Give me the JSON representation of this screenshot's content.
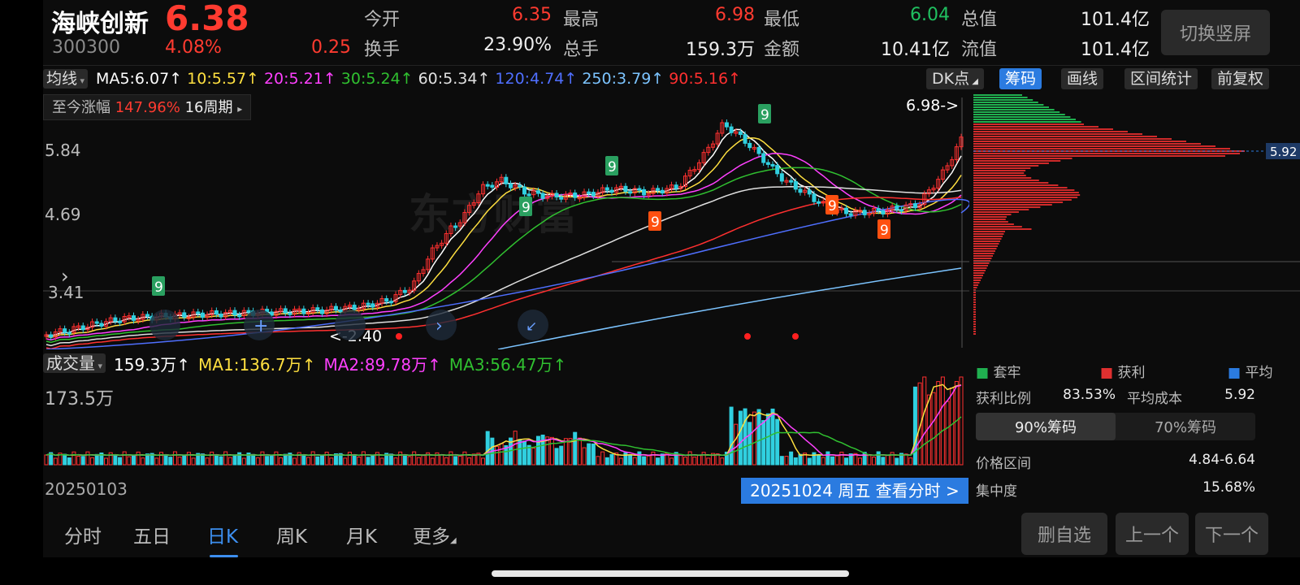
{
  "header": {
    "name": "海峡创新",
    "price": "6.38",
    "code": "300300",
    "pct": "4.08%",
    "chg": "0.25",
    "quotes": [
      {
        "label": "今开",
        "value": "6.35",
        "color": "red"
      },
      {
        "label": "最高",
        "value": "6.98",
        "color": "red"
      },
      {
        "label": "最低",
        "value": "6.04",
        "color": "green"
      },
      {
        "label": "总值",
        "value": "101.4亿",
        "color": "white"
      },
      {
        "label": "换手",
        "value": "23.90%",
        "color": "white"
      },
      {
        "label": "总手",
        "value": "159.3万",
        "color": "white"
      },
      {
        "label": "金额",
        "value": "10.41亿",
        "color": "white"
      },
      {
        "label": "流值",
        "value": "101.4亿",
        "color": "white"
      }
    ],
    "switch_label": "切换竖屏"
  },
  "ma_bar": {
    "selector": "均线",
    "items": [
      {
        "text": "MA5:6.07↑",
        "color": "#ffffff"
      },
      {
        "text": "10:5.57↑",
        "color": "#ffe040"
      },
      {
        "text": "20:5.21↑",
        "color": "#ff40ff"
      },
      {
        "text": "30:5.24↑",
        "color": "#30c030"
      },
      {
        "text": "60:5.34↑",
        "color": "#e0e0e0"
      },
      {
        "text": "120:4.74↑",
        "color": "#4f6fff"
      },
      {
        "text": "250:3.79↑",
        "color": "#7cc4ff"
      },
      {
        "text": "90:5.16↑",
        "color": "#ff3030"
      }
    ]
  },
  "tools": {
    "dk": "DK点",
    "chips": "筹码",
    "draw": "画线",
    "range": "区间统计",
    "fq": "前复权"
  },
  "since": {
    "label": "至今涨幅",
    "value": "147.96%",
    "period": "16周期"
  },
  "price_chart": {
    "y_labels": [
      "5.84",
      "4.69",
      "3.41"
    ],
    "high_label": "6.98->",
    "low_label": "<-2.40",
    "cost_label": "5.92",
    "watermark": "东方财富"
  },
  "volume": {
    "selector": "成交量",
    "items": [
      {
        "text": "159.3万↑",
        "color": "#ffffff"
      },
      {
        "text": "MA1:136.7万↑",
        "color": "#ffe040"
      },
      {
        "text": "MA2:89.78万↑",
        "color": "#ff40ff"
      },
      {
        "text": "MA3:56.47万↑",
        "color": "#30c030"
      }
    ],
    "max_label": "173.5万"
  },
  "chip_panel": {
    "legend": [
      {
        "text": "套牢",
        "color": "#20b050"
      },
      {
        "text": "获利",
        "color": "#e03030"
      },
      {
        "text": "平均",
        "color": "#2b7be0"
      }
    ],
    "profit_ratio_label": "获利比例",
    "profit_ratio": "83.53%",
    "avg_cost_label": "平均成本",
    "avg_cost": "5.92",
    "seg_90": "90%筹码",
    "seg_70": "70%筹码",
    "price_range_label": "价格区间",
    "price_range": "4.84-6.64",
    "concentration_label": "集中度",
    "concentration": "15.68%"
  },
  "bottom": {
    "start_date": "20250103",
    "tip": "20251024 周五 查看分时 >",
    "tabs": [
      "分时",
      "五日",
      "日K",
      "周K",
      "月K",
      "更多"
    ],
    "active_tab": 2,
    "btn_remove": "删自选",
    "btn_prev": "上一个",
    "btn_next": "下一个"
  }
}
